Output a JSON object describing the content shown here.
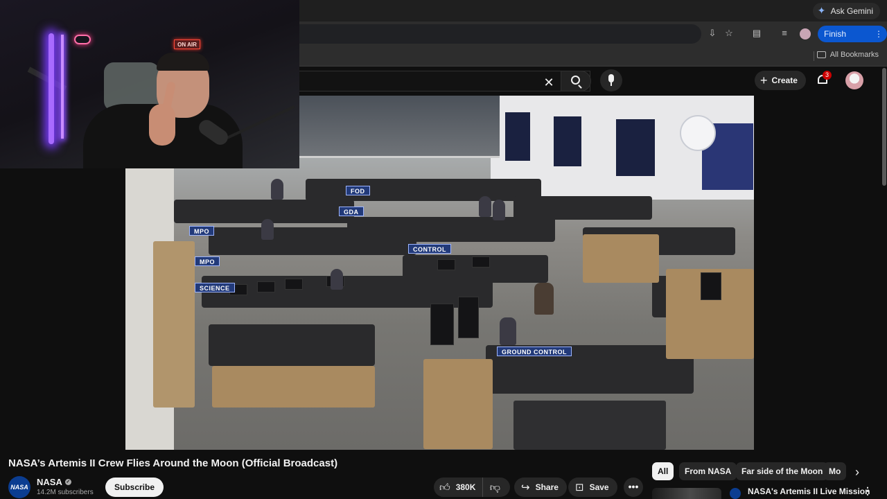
{
  "browser": {
    "gemini_label": "Ask Gemini",
    "finish_update_label": "Finish update",
    "all_bookmarks_label": "All Bookmarks"
  },
  "youtube": {
    "clear_glyph": "✕",
    "create_label": "Create",
    "notification_count": "3"
  },
  "webcam": {
    "on_air_sign": "ON AIR"
  },
  "video": {
    "title": "NASA’s Artemis II Crew Flies Around the Moon (Official Broadcast)",
    "floor_signs": [
      "MPO",
      "GDA",
      "FOD",
      "CONTROL",
      "SCIENCE",
      "GROUND CONTROL",
      "MPO"
    ]
  },
  "channel": {
    "avatar_text": "NASA",
    "name": "NASA",
    "subscribers": "14.2M subscribers",
    "subscribe_label": "Subscribe"
  },
  "actions": {
    "like_count": "380K",
    "share_label": "Share",
    "save_label": "Save",
    "more_glyph": "•••"
  },
  "chips": [
    "All",
    "From NASA",
    "Far side of the Moon",
    "Mo"
  ],
  "recommendation": {
    "title": "NASA's Artemis II Live Mission"
  },
  "icons": {
    "search": "search-icon",
    "mic": "mic-icon",
    "bell": "bell-icon",
    "like": "thumbs-up-icon",
    "dislike": "thumbs-down-icon",
    "share": "share-icon",
    "save": "save-icon"
  },
  "colors": {
    "page_bg": "#0f0f0f",
    "finish_update_bg": "#0b57d0",
    "badge": "#cc0000"
  }
}
